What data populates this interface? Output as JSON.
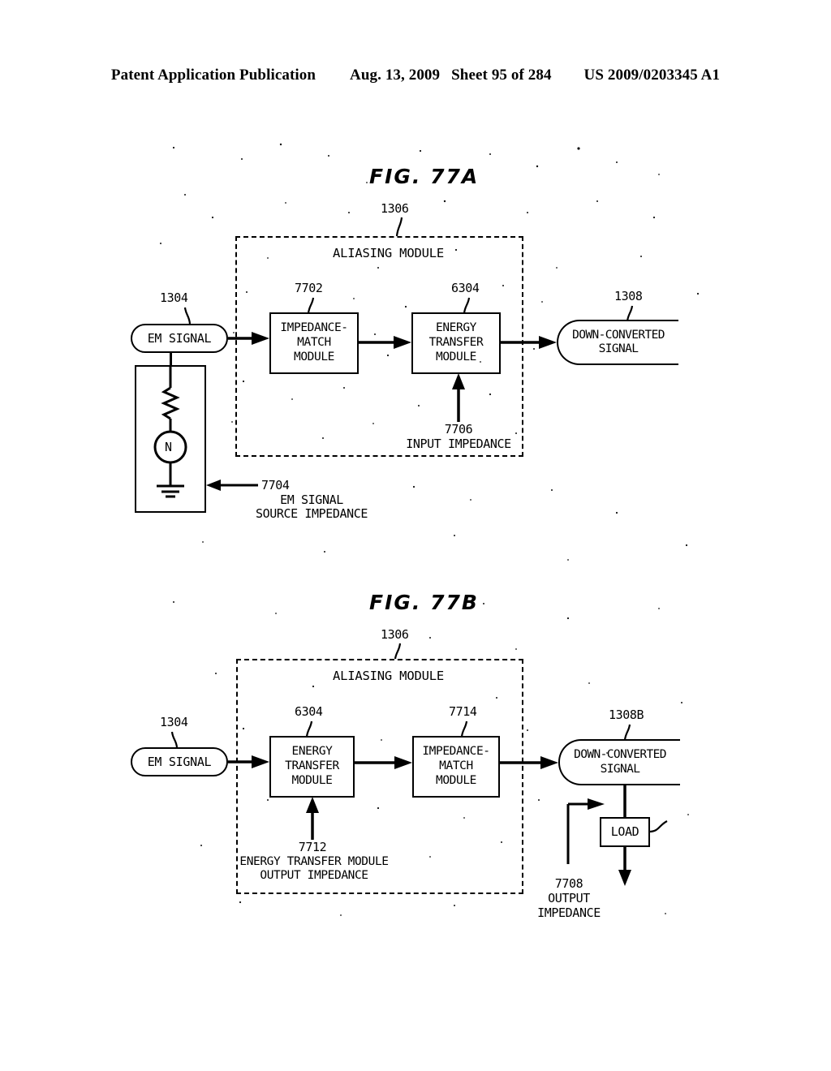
{
  "header": {
    "publication": "Patent Application Publication",
    "date": "Aug. 13, 2009",
    "sheet": "Sheet 95 of 284",
    "patent_number": "US 2009/0203345 A1"
  },
  "figures": [
    {
      "id": "fig-77a",
      "title": "FIG. 77A",
      "aliasing_module": {
        "ref": "1306",
        "label": "ALIASING MODULE"
      },
      "input": {
        "ref": "1304",
        "label": "EM SIGNAL"
      },
      "source_impedance": {
        "ref": "7704",
        "label_line1": "EM SIGNAL",
        "label_line2": "SOURCE IMPEDANCE",
        "source_symbol": "N"
      },
      "blocks": [
        {
          "ref": "7702",
          "line1": "IMPEDANCE-",
          "line2": "MATCH",
          "line3": "MODULE"
        },
        {
          "ref": "6304",
          "line1": "ENERGY",
          "line2": "TRANSFER",
          "line3": "MODULE"
        }
      ],
      "annotation": {
        "ref": "7706",
        "label": "INPUT IMPEDANCE"
      },
      "output": {
        "ref": "1308",
        "line1": "DOWN-CONVERTED",
        "line2": "SIGNAL"
      }
    },
    {
      "id": "fig-77b",
      "title": "FIG. 77B",
      "aliasing_module": {
        "ref": "1306",
        "label": "ALIASING MODULE"
      },
      "input": {
        "ref": "1304",
        "label": "EM SIGNAL"
      },
      "blocks": [
        {
          "ref": "6304",
          "line1": "ENERGY",
          "line2": "TRANSFER",
          "line3": "MODULE"
        },
        {
          "ref": "7714",
          "line1": "IMPEDANCE-",
          "line2": "MATCH",
          "line3": "MODULE"
        }
      ],
      "annotation": {
        "ref": "7712",
        "label_line1": "ENERGY TRANSFER MODULE",
        "label_line2": "OUTPUT IMPEDANCE"
      },
      "output": {
        "ref": "1308B",
        "line1": "DOWN-CONVERTED",
        "line2": "SIGNAL"
      },
      "load": {
        "label": "LOAD"
      },
      "output_impedance": {
        "ref": "7708",
        "label_line1": "OUTPUT",
        "label_line2": "IMPEDANCE"
      }
    }
  ],
  "colors": {
    "ink": "#000000",
    "paper": "#ffffff"
  }
}
